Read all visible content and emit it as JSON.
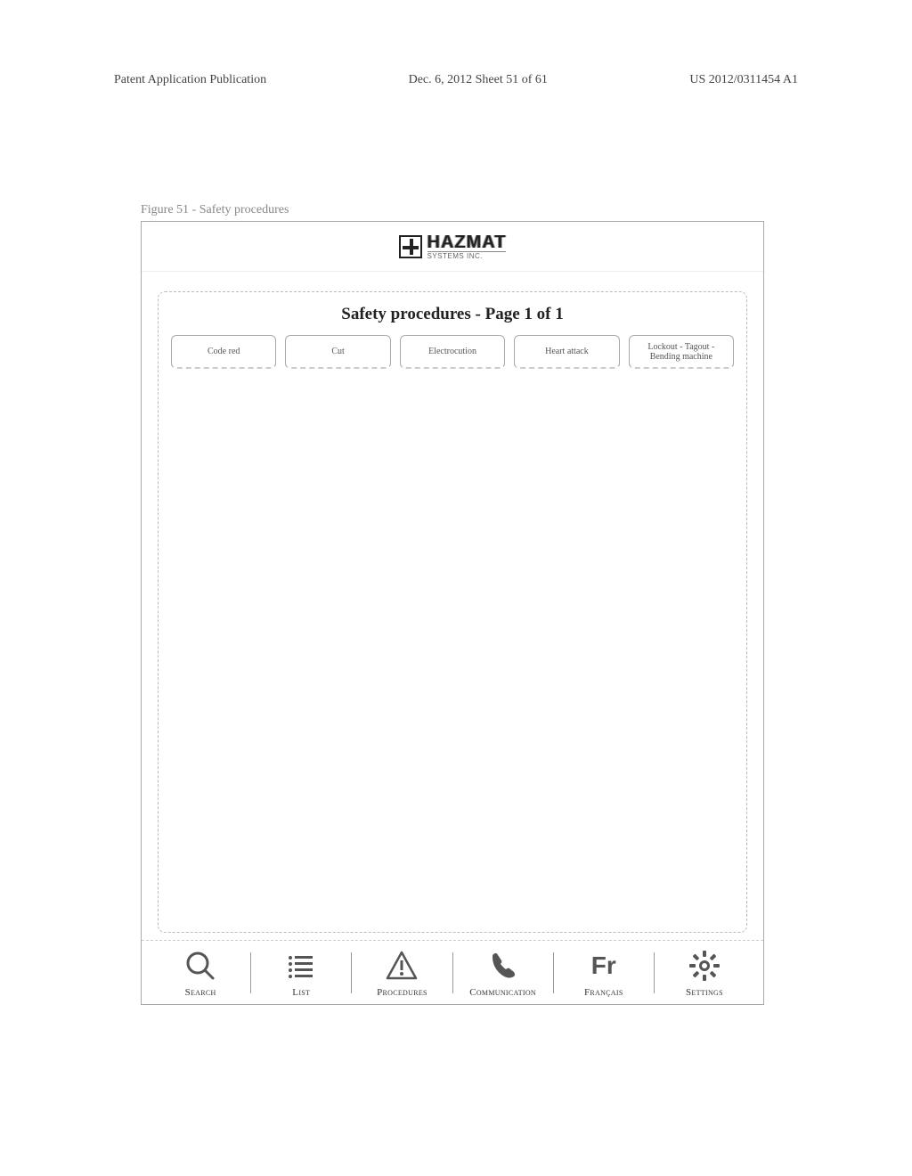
{
  "doc_header": {
    "left": "Patent Application Publication",
    "center": "Dec. 6, 2012  Sheet 51 of 61",
    "right": "US 2012/0311454 A1"
  },
  "figure_caption": "Figure 51 - Safety procedures",
  "logo": {
    "top": "HAZMAT",
    "bottom": "SYSTEMS INC."
  },
  "panel_title": "Safety procedures - Page 1 of 1",
  "procedures": [
    "Code red",
    "Cut",
    "Electrocution",
    "Heart attack",
    "Lockout - Tagout - Bending machine"
  ],
  "toolbar": [
    {
      "label": "Search",
      "icon": "search-icon"
    },
    {
      "label": "List",
      "icon": "list-icon"
    },
    {
      "label": "Procedures",
      "icon": "warning-icon"
    },
    {
      "label": "Communication",
      "icon": "phone-icon"
    },
    {
      "label": "Français",
      "icon": "fr-icon",
      "glyph": "Fr"
    },
    {
      "label": "Settings",
      "icon": "gear-icon"
    }
  ]
}
